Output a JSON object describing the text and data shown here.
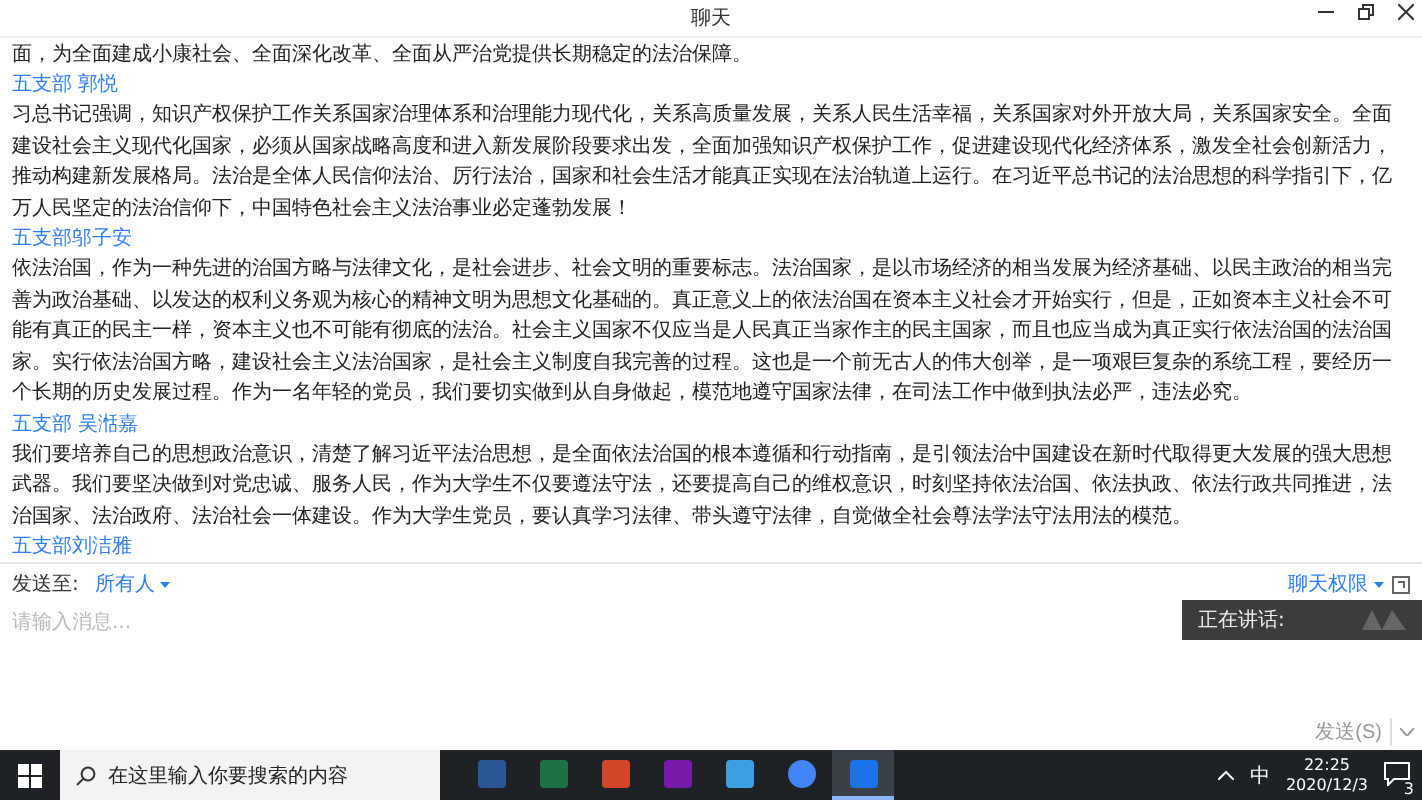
{
  "window": {
    "title": "聊天"
  },
  "messages": [
    {
      "text": "面，为全面建成小康社会、全面深化改革、全面从严治党提供长期稳定的法治保障。"
    },
    {
      "sender": "五支部 郭悦",
      "text": "习总书记强调，知识产权保护工作关系国家治理体系和治理能力现代化，关系高质量发展，关系人民生活幸福，关系国家对外开放大局，关系国家安全。全面建设社会主义现代化国家，必须从国家战略高度和进入新发展阶段要求出发，全面加强知识产权保护工作，促进建设现代化经济体系，激发全社会创新活力，推动构建新发展格局。法治是全体人民信仰法治、厉行法治，国家和社会生活才能真正实现在法治轨道上运行。在习近平总书记的法治思想的科学指引下，亿万人民坚定的法治信仰下，中国特色社会主义法治事业必定蓬勃发展！"
    },
    {
      "sender": "五支部邬子安",
      "text": "依法治国，作为一种先进的治国方略与法律文化，是社会进步、社会文明的重要标志。法治国家，是以市场经济的相当发展为经济基础、以民主政治的相当完善为政治基础、以发达的权利义务观为核心的精神文明为思想文化基础的。真正意义上的依法治国在资本主义社会才开始实行，但是，正如资本主义社会不可能有真正的民主一样，资本主义也不可能有彻底的法治。社会主义国家不仅应当是人民真正当家作主的民主国家，而且也应当成为真正实行依法治国的法治国家。实行依法治国方略，建设社会主义法治国家，是社会主义制度自我完善的过程。这也是一个前无古人的伟大创举，是一项艰巨复杂的系统工程，要经历一个长期的历史发展过程。作为一名年轻的党员，我们要切实做到从自身做起，模范地遵守国家法律，在司法工作中做到执法必严，违法必究。"
    },
    {
      "sender": "五支部 吴湉嘉",
      "text": "我们要培养自己的思想政治意识，清楚了解习近平法治思想，是全面依法治国的根本遵循和行动指南，是引领法治中国建设在新时代取得更大发展的强大思想武器。我们要坚决做到对党忠诚、服务人民，作为大学生不仅要遵法守法，还要提高自己的维权意识，时刻坚持依法治国、依法执政、依法行政共同推进，法治国家、法治政府、法治社会一体建设。作为大学生党员，要认真学习法律、带头遵守法律，自觉做全社会尊法学法守法用法的模范。"
    },
    {
      "sender": "五支部刘洁雅"
    }
  ],
  "speaking": {
    "label": "正在讲话:"
  },
  "compose": {
    "send_to_label": "发送至:",
    "recipient": "所有人",
    "permissions": "聊天权限",
    "placeholder": "请输入消息...",
    "send": "发送(S)"
  },
  "taskbar": {
    "search_placeholder": "在这里输入你要搜索的内容",
    "apps": [
      {
        "kind": "word",
        "active": false
      },
      {
        "kind": "excel",
        "active": false
      },
      {
        "kind": "powerpoint",
        "active": false
      },
      {
        "kind": "onenote",
        "active": false
      },
      {
        "kind": "telegram",
        "active": false
      },
      {
        "kind": "chrome",
        "active": false
      },
      {
        "kind": "meeting",
        "active": true
      }
    ],
    "ime": "中",
    "time": "22:25",
    "date": "2020/12/3",
    "notifications": "3"
  }
}
